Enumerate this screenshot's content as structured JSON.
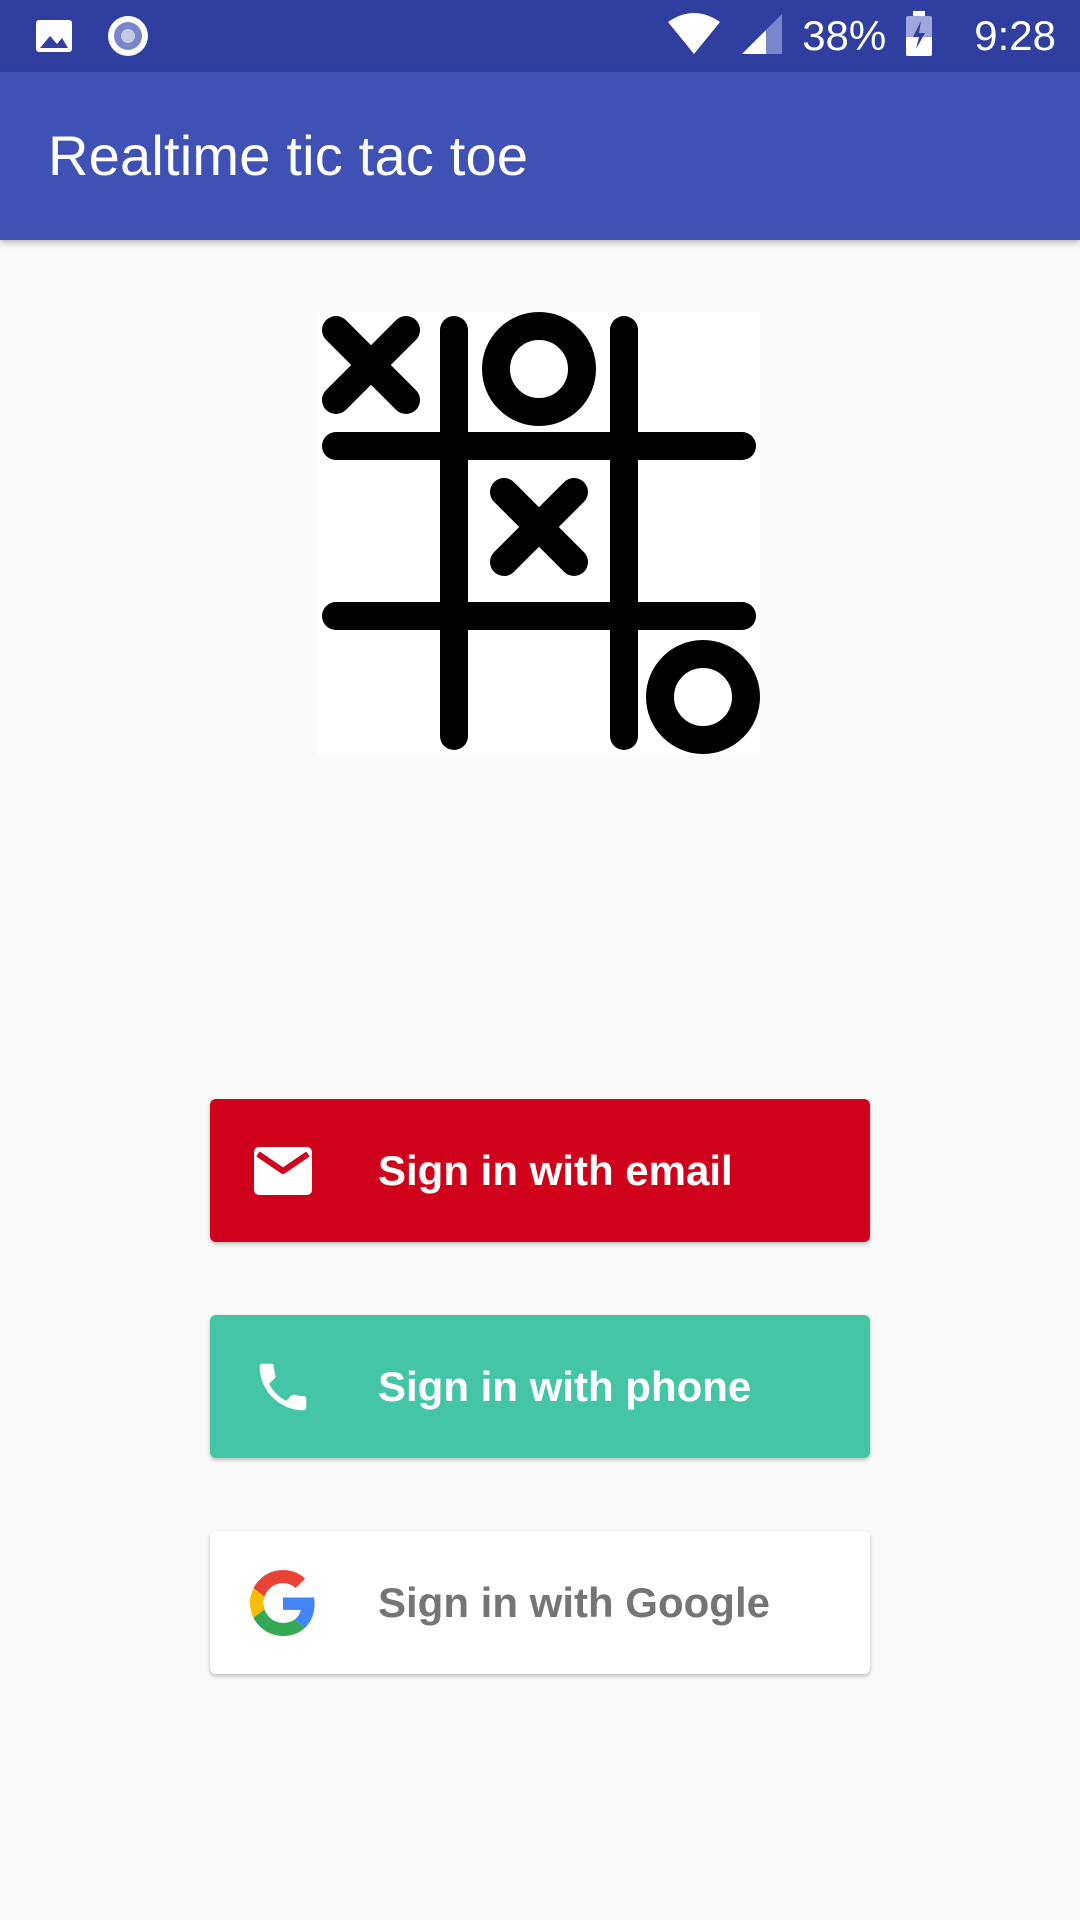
{
  "status_bar": {
    "battery": "38%",
    "time": "9:28",
    "icons": [
      "image-icon",
      "record-icon",
      "wifi-icon",
      "signal-icon",
      "battery-charging-icon"
    ]
  },
  "app_bar": {
    "title": "Realtime tic tac toe"
  },
  "logo": {
    "icon": "tic-tac-toe-logo"
  },
  "buttons": {
    "email": {
      "label": "Sign in with email",
      "icon": "email-icon",
      "color": "#d0021b"
    },
    "phone": {
      "label": "Sign in with phone",
      "icon": "phone-icon",
      "color": "#44c5a6"
    },
    "google": {
      "label": "Sign in with Google",
      "icon": "google-icon",
      "color": "#ffffff"
    }
  },
  "colors": {
    "status_bar": "#303f9f",
    "primary": "#3f51b5",
    "background": "#fafafa"
  }
}
